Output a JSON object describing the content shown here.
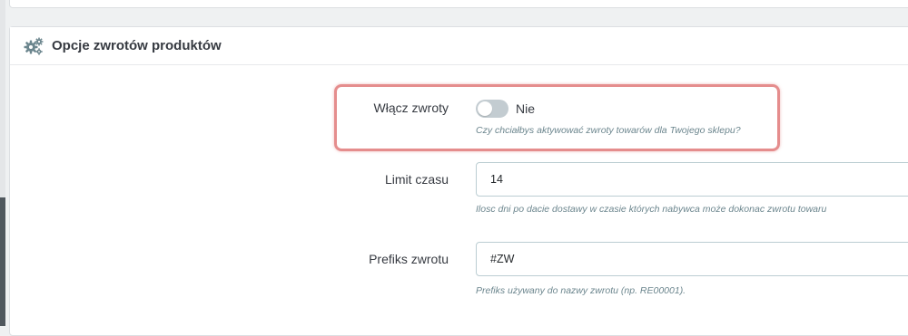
{
  "panel": {
    "title": "Opcje zwrotów produktów",
    "icon": "gears-icon"
  },
  "fields": {
    "enable_returns": {
      "label": "Włącz zwroty",
      "toggle_state": "Nie",
      "enabled": false,
      "help": "Czy chciałbys aktywować zwroty towarów dla Twojego sklepu?"
    },
    "time_limit": {
      "label": "Limit czasu",
      "value": "14",
      "help": "Ilosc dni po dacie dostawy w czasie których nabywca może dokonac zwrotu towaru"
    },
    "return_prefix": {
      "label": "Prefiks zwrotu",
      "value": "#ZW",
      "help": "Prefiks używany do nazwy zwrotu (np. RE00001)."
    }
  },
  "colors": {
    "highlight": "#e58d8d",
    "toggle_off": "#c3ccd1",
    "help_text": "#6c868e"
  }
}
